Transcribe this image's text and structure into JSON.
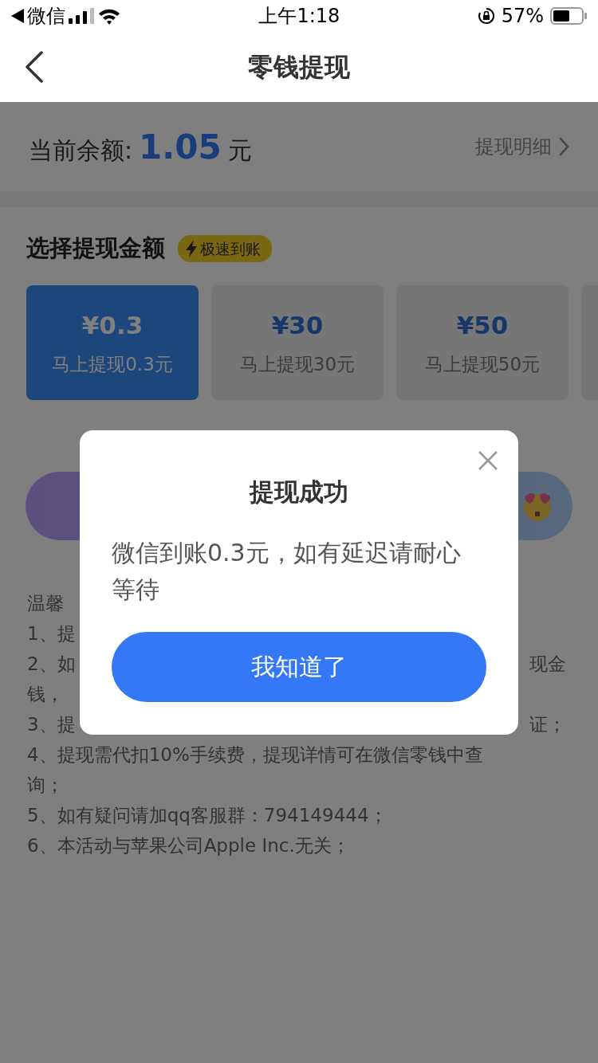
{
  "status_bar": {
    "app": "微信",
    "time": "上午1:18",
    "battery": "57%"
  },
  "nav": {
    "title": "零钱提现"
  },
  "balance": {
    "label": "当前余额:",
    "amount": "1.05",
    "unit": "元",
    "link": "提现明细"
  },
  "amount_section": {
    "title": "选择提现金额",
    "badge": "极速到账",
    "options": [
      {
        "price": "¥0.3",
        "caption": "马上提现0.3元",
        "selected": true
      },
      {
        "price": "¥30",
        "caption": "马上提现30元",
        "selected": false
      },
      {
        "price": "¥50",
        "caption": "马上提现50元",
        "selected": false
      },
      {
        "selected": false
      }
    ]
  },
  "tips": {
    "heading": "温馨",
    "lines": [
      {
        "left": "1、提"
      },
      {
        "left": "2、如",
        "right": "现金"
      },
      {
        "left": "钱，"
      },
      {
        "left": "3、提",
        "right": "证；"
      },
      {
        "left": "4、提现需代扣10%手续费，提现详情可在微信零钱中查"
      },
      {
        "left": "询；"
      },
      {
        "left": "5、如有疑问请加qq客服群：794149444；"
      },
      {
        "left": "6、本活动与苹果公司Apple Inc.无关；"
      }
    ]
  },
  "dialog": {
    "title": "提现成功",
    "message": "微信到账0.3元，如有延迟请耐心等待",
    "button": "我知道了"
  }
}
